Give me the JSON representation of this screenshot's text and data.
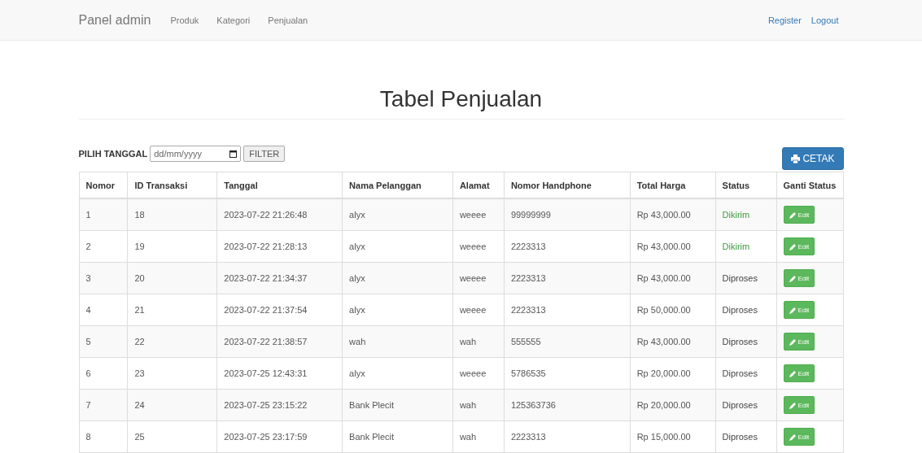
{
  "navbar": {
    "brand": "Panel admin",
    "links": [
      "Produk",
      "Kategori",
      "Penjualan"
    ],
    "right_links": [
      "Register",
      "Logout"
    ]
  },
  "title": "Tabel Penjualan",
  "filter": {
    "label": "PILIH TANGGAL",
    "date_placeholder": "dd/mm/yyyy",
    "button": "FILTER"
  },
  "print_button": "CETAK",
  "table": {
    "columns": [
      "Nomor",
      "ID Transaksi",
      "Tanggal",
      "Nama Pelanggan",
      "Alamat",
      "Nomor Handphone",
      "Total Harga",
      "Status",
      "Ganti Status"
    ],
    "rows": [
      {
        "no": "1",
        "id": "18",
        "date": "2023-07-22 21:26:48",
        "name": "alyx",
        "address": "weeee",
        "phone": "99999999",
        "total": "Rp 43,000.00",
        "status": "Dikirim",
        "color": "#3c9b3c",
        "action": "Edit"
      },
      {
        "no": "2",
        "id": "19",
        "date": "2023-07-22 21:28:13",
        "name": "alyx",
        "address": "weeee",
        "phone": "2223313",
        "total": "Rp 43,000.00",
        "status": "Dikirim",
        "color": "#3c9b3c",
        "action": "Edit"
      },
      {
        "no": "3",
        "id": "20",
        "date": "2023-07-22 21:34:37",
        "name": "alyx",
        "address": "weeee",
        "phone": "2223313",
        "total": "Rp 43,000.00",
        "status": "Diproses",
        "color": "#444444",
        "action": "Edit"
      },
      {
        "no": "4",
        "id": "21",
        "date": "2023-07-22 21:37:54",
        "name": "alyx",
        "address": "weeee",
        "phone": "2223313",
        "total": "Rp 50,000.00",
        "status": "Diproses",
        "color": "#444444",
        "action": "Edit"
      },
      {
        "no": "5",
        "id": "22",
        "date": "2023-07-22 21:38:57",
        "name": "wah",
        "address": "wah",
        "phone": "555555",
        "total": "Rp 43,000.00",
        "status": "Diproses",
        "color": "#444444",
        "action": "Edit"
      },
      {
        "no": "6",
        "id": "23",
        "date": "2023-07-25 12:43:31",
        "name": "alyx",
        "address": "weeee",
        "phone": "5786535",
        "total": "Rp 20,000.00",
        "status": "Diproses",
        "color": "#444444",
        "action": "Edit"
      },
      {
        "no": "7",
        "id": "24",
        "date": "2023-07-25 23:15:22",
        "name": "Bank Plecit",
        "address": "wah",
        "phone": "125363736",
        "total": "Rp 20,000.00",
        "status": "Diproses",
        "color": "#444444",
        "action": "Edit"
      },
      {
        "no": "8",
        "id": "25",
        "date": "2023-07-25 23:17:59",
        "name": "Bank Plecit",
        "address": "wah",
        "phone": "2223313",
        "total": "Rp 15,000.00",
        "status": "Diproses",
        "color": "#444444",
        "action": "Edit"
      }
    ]
  }
}
